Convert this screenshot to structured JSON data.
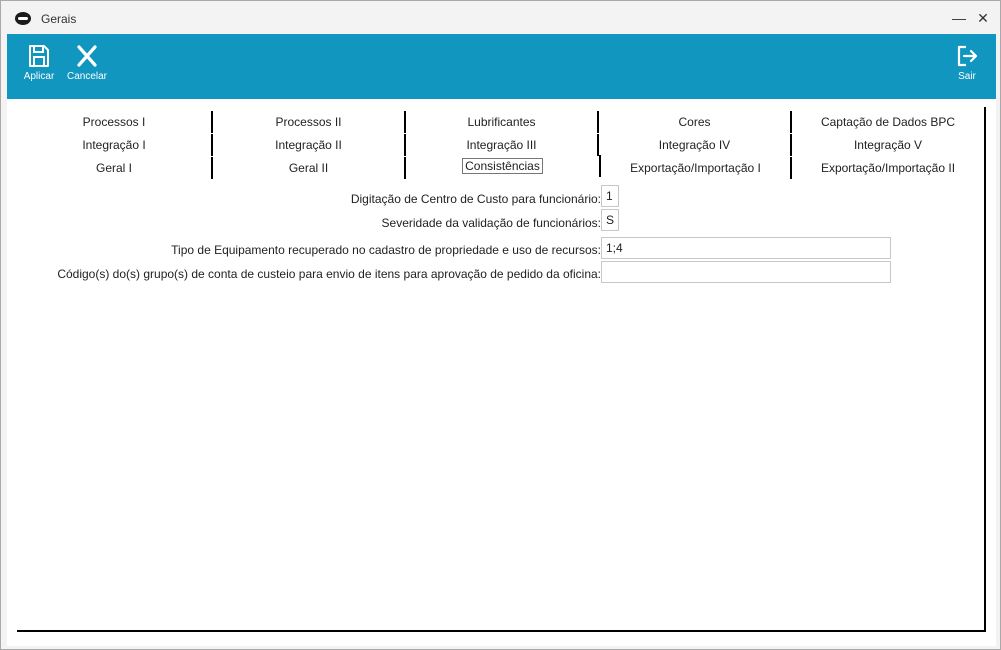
{
  "window": {
    "title": "Gerais",
    "minimize_glyph": "—",
    "close_glyph": "✕"
  },
  "toolbar": {
    "apply_label": "Aplicar",
    "cancel_label": "Cancelar",
    "exit_label": "Sair",
    "background": "#1196c0"
  },
  "tabs": {
    "row1": [
      "Processos I",
      "Processos II",
      "Lubrificantes",
      "Cores",
      "Captação de Dados BPC"
    ],
    "row2": [
      "Integração I",
      "Integração II",
      "Integração III",
      "Integração IV",
      "Integração V"
    ],
    "row3": [
      "Geral I",
      "Geral II",
      "Consistências",
      "Exportação/Importação I",
      "Exportação/Importação II"
    ],
    "active": "Consistências"
  },
  "form": {
    "cost_center_label": "Digitação de Centro de Custo para funcionário:",
    "cost_center_value": "1",
    "severity_label": "Severidade da validação de funcionários:",
    "severity_value": "S",
    "equipment_type_label": "Tipo de Equipamento recuperado no cadastro de propriedade e uso de recursos:",
    "equipment_type_value": "1;4",
    "account_group_label": "Código(s) do(s) grupo(s) de conta de custeio para envio de itens para aprovação de pedido da oficina:",
    "account_group_value": ""
  }
}
